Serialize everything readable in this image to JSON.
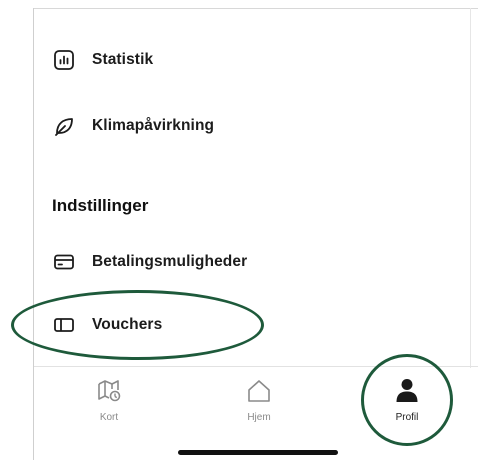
{
  "menu": {
    "items": [
      {
        "label": "Statistik",
        "icon": "statistics-icon"
      },
      {
        "label": "Klimapåvirkning",
        "icon": "leaf-icon"
      }
    ],
    "settings_title": "Indstillinger",
    "settings_items": [
      {
        "label": "Betalingsmuligheder",
        "icon": "credit-card-icon"
      },
      {
        "label": "Vouchers",
        "icon": "voucher-icon"
      }
    ]
  },
  "tabbar": {
    "tabs": [
      {
        "label": "Kort",
        "icon": "map-icon"
      },
      {
        "label": "Hjem",
        "icon": "home-icon"
      },
      {
        "label": "Profil",
        "icon": "person-icon",
        "active": true
      }
    ]
  },
  "colors": {
    "accent": "#1e5a3b",
    "text": "#1c1c1c",
    "muted": "#8a8a8a"
  }
}
